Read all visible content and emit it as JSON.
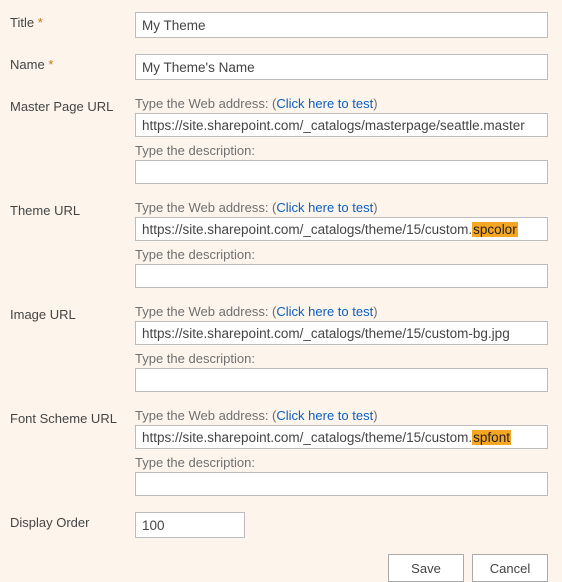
{
  "labels": {
    "title": "Title",
    "name": "Name",
    "master": "Master Page URL",
    "theme": "Theme URL",
    "image": "Image URL",
    "font": "Font Scheme URL",
    "order": "Display Order",
    "required": "*"
  },
  "hints": {
    "address": "Type the Web address: (",
    "test": "Click here to test",
    "address_close": ")",
    "description": "Type the description:"
  },
  "values": {
    "title": "My Theme",
    "name": "My Theme's Name",
    "master": "https://site.sharepoint.com/_catalogs/masterpage/seattle.master",
    "theme_pre": "https://site.sharepoint.com/_catalogs/theme/15/custom.",
    "theme_hl": "spcolor",
    "image": "https://site.sharepoint.com/_catalogs/theme/15/custom-bg.jpg",
    "font_pre": "https://site.sharepoint.com/_catalogs/theme/15/custom.",
    "font_hl": "spfont",
    "order": "100"
  },
  "buttons": {
    "save": "Save",
    "cancel": "Cancel"
  }
}
